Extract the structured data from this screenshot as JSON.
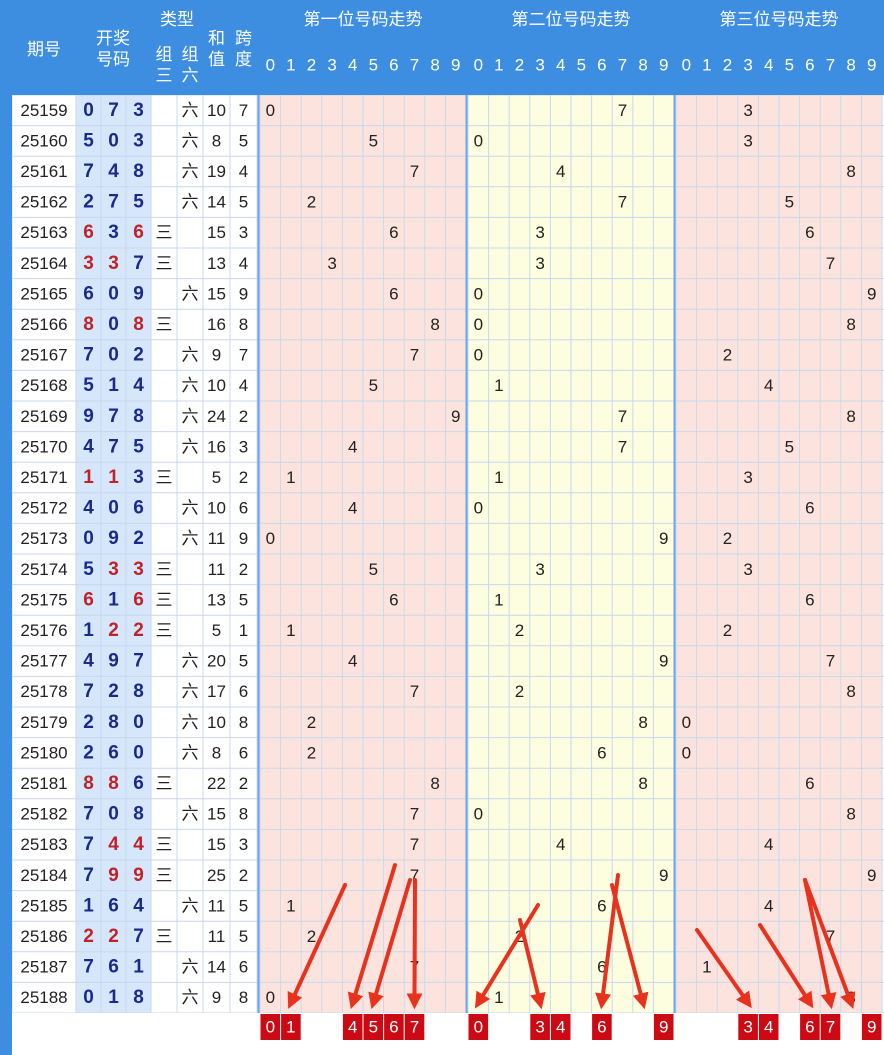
{
  "header": {
    "period_label": "期号",
    "draw_label": "开奖号码",
    "type_label": "类型",
    "type_group3": "组三",
    "type_group6": "组六",
    "sum_label": "和值",
    "span_label": "跨度",
    "pos1_title": "第一位号码走势",
    "pos2_title": "第二位号码走势",
    "pos3_title": "第三位号码走势",
    "digits": [
      "0",
      "1",
      "2",
      "3",
      "4",
      "5",
      "6",
      "7",
      "8",
      "9"
    ]
  },
  "colors": {
    "header_bg": "#3d8ee0",
    "zone1_bg": "#fde3de",
    "zone2_bg": "#fdfde0",
    "zone3_bg": "#fde3de",
    "draw_bg": "#d6e6fb",
    "blue_digit": "#1a2a8c",
    "red_digit": "#c0222a",
    "box_red": "#cc0a14",
    "arrow": "#e8321e",
    "grid_line": "#c8d8ec"
  },
  "chart_data": {
    "type": "table",
    "title": "",
    "type_labels": {
      "g3": "三",
      "g6": "六"
    },
    "rows": [
      {
        "period": "25159",
        "digits": [
          0,
          7,
          3
        ],
        "type": "g6",
        "sum": 10,
        "span": 7
      },
      {
        "period": "25160",
        "digits": [
          5,
          0,
          3
        ],
        "type": "g6",
        "sum": 8,
        "span": 5
      },
      {
        "period": "25161",
        "digits": [
          7,
          4,
          8
        ],
        "type": "g6",
        "sum": 19,
        "span": 4
      },
      {
        "period": "25162",
        "digits": [
          2,
          7,
          5
        ],
        "type": "g6",
        "sum": 14,
        "span": 5
      },
      {
        "period": "25163",
        "digits": [
          6,
          3,
          6
        ],
        "type": "g3",
        "sum": 15,
        "span": 3
      },
      {
        "period": "25164",
        "digits": [
          3,
          3,
          7
        ],
        "type": "g3",
        "sum": 13,
        "span": 4
      },
      {
        "period": "25165",
        "digits": [
          6,
          0,
          9
        ],
        "type": "g6",
        "sum": 15,
        "span": 9
      },
      {
        "period": "25166",
        "digits": [
          8,
          0,
          8
        ],
        "type": "g3",
        "sum": 16,
        "span": 8
      },
      {
        "period": "25167",
        "digits": [
          7,
          0,
          2
        ],
        "type": "g6",
        "sum": 9,
        "span": 7
      },
      {
        "period": "25168",
        "digits": [
          5,
          1,
          4
        ],
        "type": "g6",
        "sum": 10,
        "span": 4
      },
      {
        "period": "25169",
        "digits": [
          9,
          7,
          8
        ],
        "type": "g6",
        "sum": 24,
        "span": 2
      },
      {
        "period": "25170",
        "digits": [
          4,
          7,
          5
        ],
        "type": "g6",
        "sum": 16,
        "span": 3
      },
      {
        "period": "25171",
        "digits": [
          1,
          1,
          3
        ],
        "type": "g3",
        "sum": 5,
        "span": 2
      },
      {
        "period": "25172",
        "digits": [
          4,
          0,
          6
        ],
        "type": "g6",
        "sum": 10,
        "span": 6
      },
      {
        "period": "25173",
        "digits": [
          0,
          9,
          2
        ],
        "type": "g6",
        "sum": 11,
        "span": 9
      },
      {
        "period": "25174",
        "digits": [
          5,
          3,
          3
        ],
        "type": "g3",
        "sum": 11,
        "span": 2
      },
      {
        "period": "25175",
        "digits": [
          6,
          1,
          6
        ],
        "type": "g3",
        "sum": 13,
        "span": 5
      },
      {
        "period": "25176",
        "digits": [
          1,
          2,
          2
        ],
        "type": "g3",
        "sum": 5,
        "span": 1
      },
      {
        "period": "25177",
        "digits": [
          4,
          9,
          7
        ],
        "type": "g6",
        "sum": 20,
        "span": 5
      },
      {
        "period": "25178",
        "digits": [
          7,
          2,
          8
        ],
        "type": "g6",
        "sum": 17,
        "span": 6
      },
      {
        "period": "25179",
        "digits": [
          2,
          8,
          0
        ],
        "type": "g6",
        "sum": 10,
        "span": 8
      },
      {
        "period": "25180",
        "digits": [
          2,
          6,
          0
        ],
        "type": "g6",
        "sum": 8,
        "span": 6
      },
      {
        "period": "25181",
        "digits": [
          8,
          8,
          6
        ],
        "type": "g3",
        "sum": 22,
        "span": 2
      },
      {
        "period": "25182",
        "digits": [
          7,
          0,
          8
        ],
        "type": "g6",
        "sum": 15,
        "span": 8
      },
      {
        "period": "25183",
        "digits": [
          7,
          4,
          4
        ],
        "type": "g3",
        "sum": 15,
        "span": 3
      },
      {
        "period": "25184",
        "digits": [
          7,
          9,
          9
        ],
        "type": "g3",
        "sum": 25,
        "span": 2
      },
      {
        "period": "25185",
        "digits": [
          1,
          6,
          4
        ],
        "type": "g6",
        "sum": 11,
        "span": 5
      },
      {
        "period": "25186",
        "digits": [
          2,
          2,
          7
        ],
        "type": "g3",
        "sum": 11,
        "span": 5
      },
      {
        "period": "25187",
        "digits": [
          7,
          6,
          1
        ],
        "type": "g6",
        "sum": 14,
        "span": 6
      },
      {
        "period": "25188",
        "digits": [
          0,
          1,
          8
        ],
        "type": "g6",
        "sum": 9,
        "span": 8
      }
    ],
    "predictions": {
      "pos1": [
        0,
        1,
        4,
        5,
        6,
        7
      ],
      "pos2": [
        0,
        3,
        4,
        6,
        9
      ],
      "pos3": [
        3,
        4,
        6,
        7,
        9
      ]
    },
    "arrow_targets": {
      "pos1": [
        1,
        4,
        5,
        7
      ],
      "pos2": [
        0,
        3,
        6,
        8
      ],
      "pos3": [
        3,
        6,
        7,
        8
      ]
    }
  }
}
